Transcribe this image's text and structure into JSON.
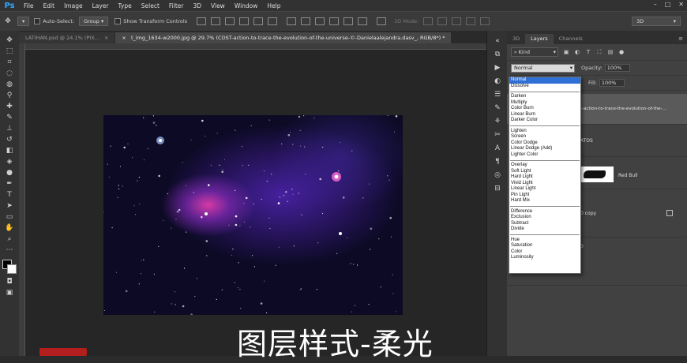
{
  "app": {
    "logo": "Ps"
  },
  "menu": [
    "File",
    "Edit",
    "Image",
    "Layer",
    "Type",
    "Select",
    "Filter",
    "3D",
    "View",
    "Window",
    "Help"
  ],
  "options_bar": {
    "auto_select_label": "Auto-Select:",
    "auto_select_value": "Group",
    "show_transform_label": "Show Transform Controls",
    "mode_3d_label": "3D Mode:",
    "workspace_value": "3D"
  },
  "document_tabs": [
    {
      "label": "LATIHAN.psd @ 24.1% (PIX..."
    },
    {
      "label": "t_img_1634-w2000.jpg @ 29.7% (COST-action-to-trace-the-evolution-of-the-universe-©-Danielaalejandra.dasv_, RGB/8*) *"
    }
  ],
  "layers_panel": {
    "tabs": [
      "3D",
      "Layers",
      "Channels"
    ],
    "filter_kind": "Kind",
    "blend_mode": "Normal",
    "opacity_label": "Opacity:",
    "opacity_value": "100%",
    "fill_label": "Fill:",
    "fill_value": "100%",
    "layer_names": [
      "t-action-to-trace-the-evolution-of-the-...",
      "ATOS",
      "Red Bull",
      "0 copy",
      "0"
    ]
  },
  "blend_menu": {
    "groups": [
      [
        "Normal",
        "Dissolve"
      ],
      [
        "Darken",
        "Multiply",
        "Color Burn",
        "Linear Burn",
        "Darker Color"
      ],
      [
        "Lighten",
        "Screen",
        "Color Dodge",
        "Linear Dodge (Add)",
        "Lighter Color"
      ],
      [
        "Overlay",
        "Soft Light",
        "Hard Light",
        "Vivid Light",
        "Linear Light",
        "Pin Light",
        "Hard Mix"
      ],
      [
        "Difference",
        "Exclusion",
        "Subtract",
        "Divide"
      ],
      [
        "Hue",
        "Saturation",
        "Color",
        "Luminosity"
      ]
    ],
    "selected": "Normal"
  },
  "caption": "图层样式-柔光",
  "colors": {
    "menu_bar": "#323232",
    "panel": "#414141",
    "accent_selected": "#2f6fd6",
    "ps_blue": "#31a8ff"
  }
}
